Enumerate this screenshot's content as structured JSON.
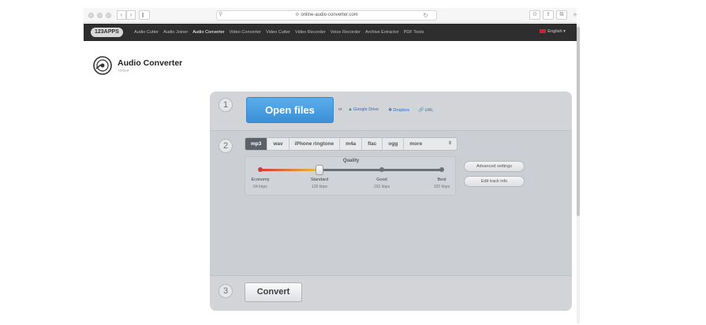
{
  "browser": {
    "url": "online-audio-converter.com"
  },
  "topnav": {
    "brand": "123APPS",
    "links": [
      "Audio Cutter",
      "Audio Joiner",
      "Audio Converter",
      "Video Converter",
      "Video Cutter",
      "Video Recorder",
      "Voice Recorder",
      "Archive Extractor",
      "PDF Tools"
    ],
    "active_index": 2,
    "language": "English"
  },
  "app": {
    "title": "Audio Converter",
    "subtitle": "online"
  },
  "step1": {
    "number": "1",
    "open_label": "Open files",
    "or_label": "or",
    "sources": [
      "Google Drive",
      "Dropbox",
      "URL"
    ]
  },
  "step2": {
    "number": "2",
    "formats": [
      "mp3",
      "wav",
      "iPhone ringtone",
      "m4a",
      "flac",
      "ogg",
      "more"
    ],
    "selected_format": "mp3",
    "quality": {
      "label": "Quality",
      "levels": [
        {
          "name": "Economy",
          "kbps": "64 kbps"
        },
        {
          "name": "Standard",
          "kbps": "128 kbps"
        },
        {
          "name": "Good",
          "kbps": "192 kbps"
        },
        {
          "name": "Best",
          "kbps": "320 kbps"
        }
      ],
      "selected_level": "Standard"
    },
    "advanced_label": "Advanced settings",
    "track_info_label": "Edit track info"
  },
  "step3": {
    "number": "3",
    "convert_label": "Convert"
  },
  "colors": {
    "open_button": "#4a9ee2",
    "nav_bg": "#2e2e2e",
    "panel_bg": "#cbced3",
    "link": "#2a6cc2"
  }
}
